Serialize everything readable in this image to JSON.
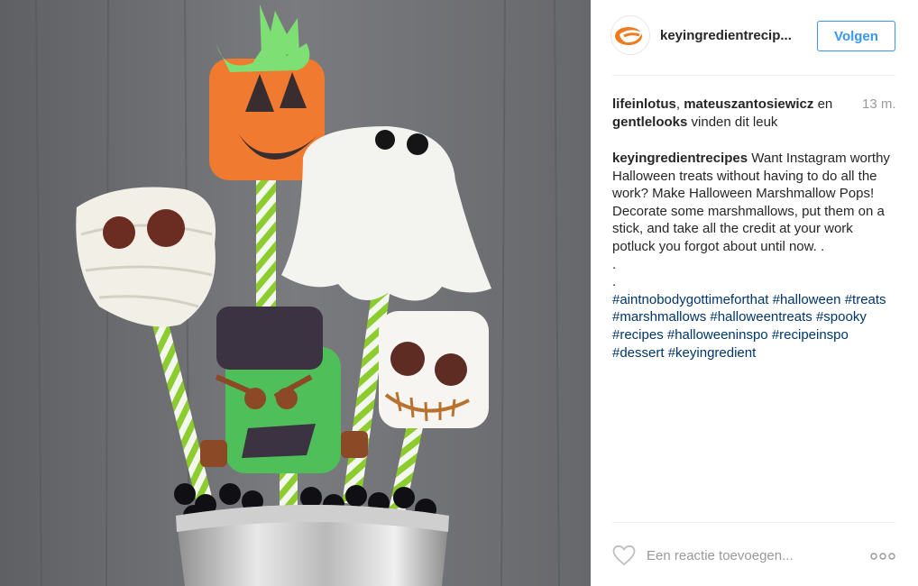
{
  "post": {
    "photo_alt": "Halloween marshmallow pops in a silver cup",
    "author": {
      "username": "keyingredientrecip...",
      "follow_label": "Volgen"
    },
    "likes": {
      "user_1": "lifeinlotus",
      "separator": ", ",
      "user_2": "mateuszantosiewicz",
      "connector": " en",
      "user_3": "gentlelooks",
      "suffix": " vinden dit leuk"
    },
    "timestamp": "13 m.",
    "caption": {
      "username": "keyingredientrecipes",
      "text": " Want Instagram worthy Halloween treats without having to do all the work? Make Halloween Marshmallow Pops! Decorate some marshmallows, put them on a stick, and take all the credit at your work potluck you forgot about until now. .",
      "dot_1": ".",
      "dot_2": ".",
      "hashtags": [
        "#aintnobodygottimeforthat",
        "#halloween",
        "#treats",
        "#marshmallows",
        "#halloweentreats",
        "#spooky",
        "#recipes",
        "#halloweeninspo",
        "#recipeinspo",
        "#dessert",
        "#keyingredient"
      ]
    },
    "comment": {
      "placeholder": "Een reactie toevoegen..."
    }
  },
  "colors": {
    "follow_blue": "#3897f0",
    "hashtag_blue": "#003569",
    "muted_gray": "#999999",
    "avatar_orange": "#f07a1e"
  },
  "icons": {
    "like": "heart-outline-icon",
    "options": "more-dots-icon"
  }
}
